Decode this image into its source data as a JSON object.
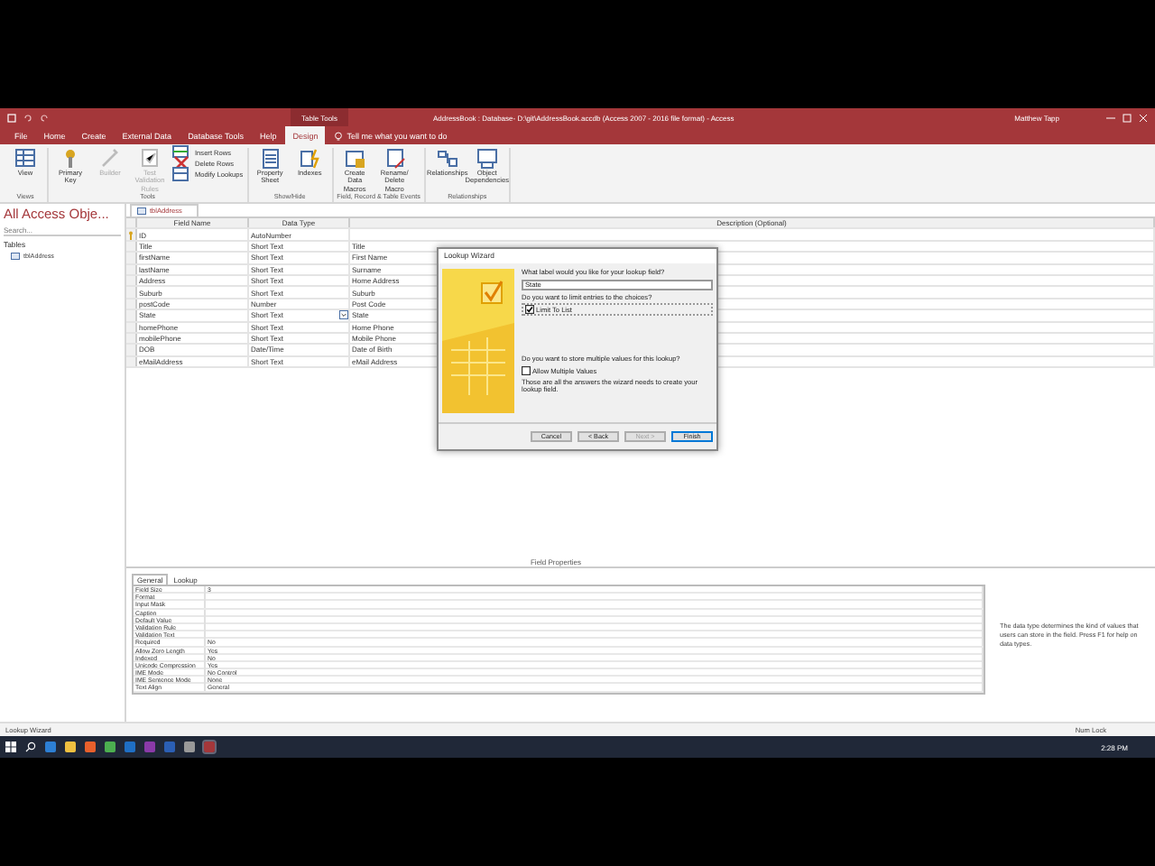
{
  "window": {
    "title": "AddressBook : Database- D:\\git\\AddressBook.accdb (Access 2007 - 2016 file format)  -  Access",
    "context_group": "Table Tools",
    "user": "Matthew Tapp"
  },
  "menu_tabs": [
    {
      "label": "File",
      "selected": false
    },
    {
      "label": "Home",
      "selected": false
    },
    {
      "label": "Create",
      "selected": false
    },
    {
      "label": "External Data",
      "selected": false
    },
    {
      "label": "Database Tools",
      "selected": false
    },
    {
      "label": "Help",
      "selected": false
    },
    {
      "label": "Design",
      "selected": true
    }
  ],
  "tell_me": "Tell me what you want to do",
  "ribbon_groups": [
    {
      "label": "Views",
      "commands": [
        {
          "label": "View",
          "kind": "large",
          "disabled": false
        }
      ]
    },
    {
      "label": "Tools",
      "commands": [
        {
          "label": "Primary Key",
          "kind": "large",
          "disabled": false
        },
        {
          "label": "Builder",
          "kind": "large",
          "disabled": true
        },
        {
          "label": "Test Validation Rules",
          "kind": "large",
          "disabled": true
        },
        {
          "label": "Insert Rows",
          "kind": "small",
          "disabled": false
        },
        {
          "label": "Delete Rows",
          "kind": "small",
          "disabled": false
        },
        {
          "label": "Modify Lookups",
          "kind": "small",
          "disabled": false
        }
      ]
    },
    {
      "label": "Show/Hide",
      "commands": [
        {
          "label": "Property Sheet",
          "kind": "large",
          "disabled": false
        },
        {
          "label": "Indexes",
          "kind": "large",
          "disabled": false
        }
      ]
    },
    {
      "label": "Field, Record & Table Events",
      "commands": [
        {
          "label": "Create Data Macros",
          "kind": "large",
          "disabled": false
        },
        {
          "label": "Rename/ Delete Macro",
          "kind": "large",
          "disabled": false
        }
      ]
    },
    {
      "label": "Relationships",
      "commands": [
        {
          "label": "Relationships",
          "kind": "large",
          "disabled": false
        },
        {
          "label": "Object Dependencies",
          "kind": "large",
          "disabled": false
        }
      ]
    }
  ],
  "nav_pane": {
    "title": "All Access Obje...",
    "search_placeholder": "Search...",
    "sections": [
      {
        "label": "Tables",
        "items": [
          {
            "label": "tblAddress"
          }
        ]
      }
    ]
  },
  "document_tab": "tblAddress",
  "design_grid": {
    "columns": [
      "Field Name",
      "Data Type",
      "Description (Optional)"
    ],
    "rows": [
      {
        "field": "ID",
        "type": "AutoNumber",
        "description": "",
        "primary_key": true,
        "current": false
      },
      {
        "field": "Title",
        "type": "Short Text",
        "description": "Title",
        "primary_key": false,
        "current": false
      },
      {
        "field": "firstName",
        "type": "Short Text",
        "description": "First Name",
        "primary_key": false,
        "current": false
      },
      {
        "field": "lastName",
        "type": "Short Text",
        "description": "Surname",
        "primary_key": false,
        "current": false
      },
      {
        "field": "Address",
        "type": "Short Text",
        "description": "Home Address",
        "primary_key": false,
        "current": false
      },
      {
        "field": "Suburb",
        "type": "Short Text",
        "description": "Suburb",
        "primary_key": false,
        "current": false
      },
      {
        "field": "postCode",
        "type": "Number",
        "description": "Post Code",
        "primary_key": false,
        "current": false
      },
      {
        "field": "State",
        "type": "Short Text",
        "description": "State",
        "primary_key": false,
        "current": true
      },
      {
        "field": "homePhone",
        "type": "Short Text",
        "description": "Home Phone",
        "primary_key": false,
        "current": false
      },
      {
        "field": "mobilePhone",
        "type": "Short Text",
        "description": "Mobile Phone",
        "primary_key": false,
        "current": false
      },
      {
        "field": "DOB",
        "type": "Date/Time",
        "description": "Date of Birth",
        "primary_key": false,
        "current": false
      },
      {
        "field": "eMailAddress",
        "type": "Short Text",
        "description": "eMail Address",
        "primary_key": false,
        "current": false
      }
    ]
  },
  "field_properties": {
    "title": "Field Properties",
    "tabs": [
      {
        "label": "General",
        "selected": true
      },
      {
        "label": "Lookup",
        "selected": false
      }
    ],
    "rows": [
      {
        "name": "Field Size",
        "value": "3"
      },
      {
        "name": "Format",
        "value": ""
      },
      {
        "name": "Input Mask",
        "value": ""
      },
      {
        "name": "Caption",
        "value": ""
      },
      {
        "name": "Default Value",
        "value": ""
      },
      {
        "name": "Validation Rule",
        "value": ""
      },
      {
        "name": "Validation Text",
        "value": ""
      },
      {
        "name": "Required",
        "value": "No"
      },
      {
        "name": "Allow Zero Length",
        "value": "Yes"
      },
      {
        "name": "Indexed",
        "value": "No"
      },
      {
        "name": "Unicode Compression",
        "value": "Yes"
      },
      {
        "name": "IME Mode",
        "value": "No Control"
      },
      {
        "name": "IME Sentence Mode",
        "value": "None"
      },
      {
        "name": "Text Align",
        "value": "General"
      }
    ],
    "help": "The data type determines the kind of values that users can store in the field. Press F1 for help on data types."
  },
  "dialog": {
    "title": "Lookup Wizard",
    "label_question": "What label would you like for your lookup field?",
    "label_value": "State",
    "limit_question": "Do you want to limit entries to the choices?",
    "limit_label": "Limit To List",
    "limit_checked": true,
    "multi_question": "Do you want to store multiple values for this lookup?",
    "multi_label": "Allow Multiple Values",
    "multi_checked": false,
    "summary": "Those are all the answers the wizard needs to create your lookup field.",
    "buttons": [
      {
        "label": "Cancel",
        "disabled": false,
        "default": false
      },
      {
        "label": "< Back",
        "disabled": false,
        "default": false
      },
      {
        "label": "Next >",
        "disabled": true,
        "default": false
      },
      {
        "label": "Finish",
        "disabled": false,
        "default": true
      }
    ]
  },
  "status_bar": {
    "left": "Lookup Wizard",
    "right": "Num Lock"
  },
  "taskbar": {
    "clock": "2:28 PM"
  }
}
